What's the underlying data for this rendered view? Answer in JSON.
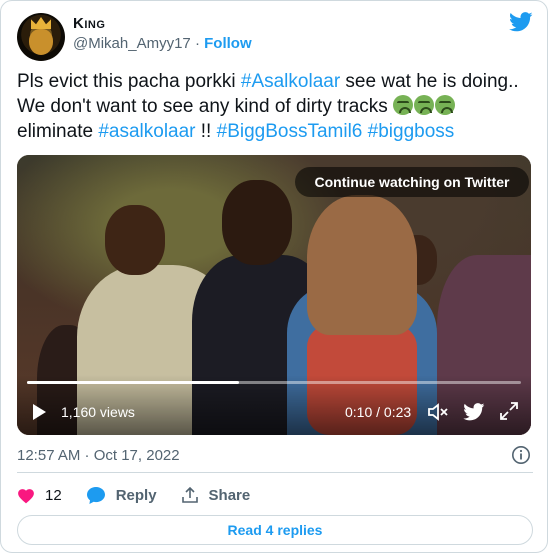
{
  "author": {
    "display_name": "King",
    "handle": "@Mikah_Amyy17",
    "separator": "·",
    "follow_label": "Follow"
  },
  "tweet": {
    "text_parts": {
      "t1": "Pls evict this pacha porkki ",
      "h1": "#Asalkolaar",
      "t2": " see wat he is doing.. We don't want to see any kind of dirty tracks ",
      "t3": " eliminate ",
      "h2": "#asalkolaar",
      "t4": " !! ",
      "h3": "#BiggBossTamil6",
      "t5": " ",
      "h4": "#biggboss"
    },
    "emoji_names": [
      "nauseated-face-emoji",
      "nauseated-face-emoji",
      "nauseated-face-emoji"
    ]
  },
  "video": {
    "continue_label": "Continue watching on Twitter",
    "views": "1,160 views",
    "time": "0:10 / 0:23",
    "progress": 0.43
  },
  "timestamp": "12:57 AM · Oct 17, 2022",
  "actions": {
    "likes": "12",
    "reply_label": "Reply",
    "share_label": "Share"
  },
  "read_replies_label": "Read 4 replies",
  "colors": {
    "accent": "#1d9bf0",
    "heart": "#f91880",
    "muted": "#536471",
    "border": "#cfd9de"
  }
}
